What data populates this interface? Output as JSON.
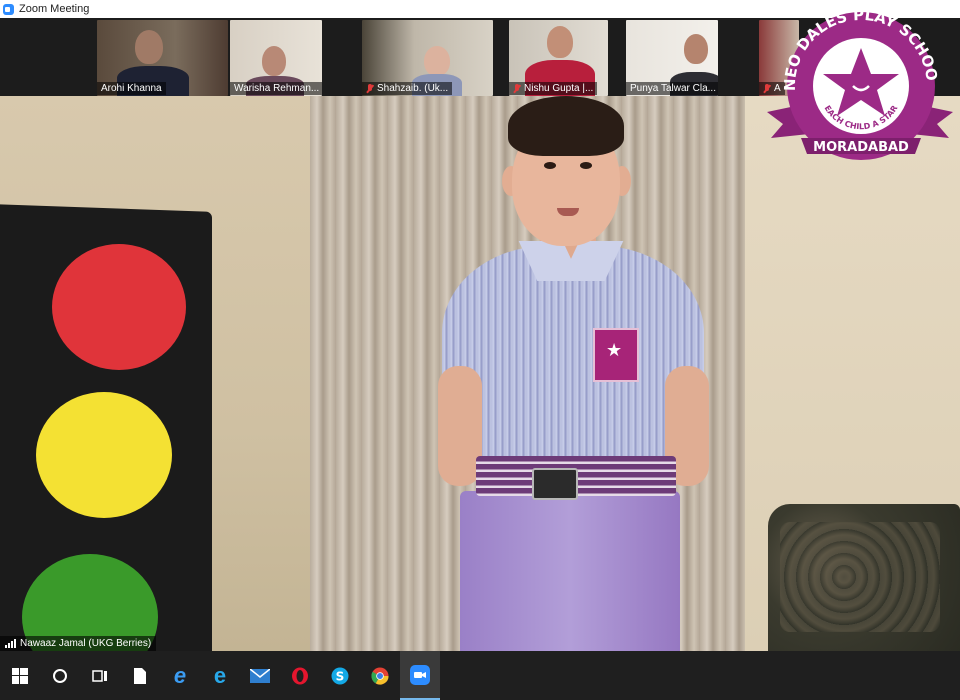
{
  "window": {
    "title": "Zoom Meeting"
  },
  "participants": [
    {
      "name": "Arohi Khanna",
      "muted": false
    },
    {
      "name": "Warisha Rehman...",
      "muted": false
    },
    {
      "name": "Shahzaib. (Uk...",
      "muted": true
    },
    {
      "name": "Nishu Gupta |...",
      "muted": true
    },
    {
      "name": "Punya Talwar Cla...",
      "muted": false
    },
    {
      "name": "A",
      "muted": true
    }
  ],
  "main_video": {
    "speaker_name": "Nawaaz Jamal (UKG Berries)"
  },
  "logo": {
    "top_text": "NEO DALES PLAY SCHOOL",
    "tagline": "EACH CHILD A STAR",
    "city": "MORADABAD",
    "color": "#9c2a86"
  },
  "taskbar": {
    "items": [
      "windows-start",
      "cortana",
      "task-view",
      "file",
      "edge",
      "internet-explorer",
      "mail",
      "opera",
      "skype",
      "chrome",
      "zoom"
    ]
  }
}
